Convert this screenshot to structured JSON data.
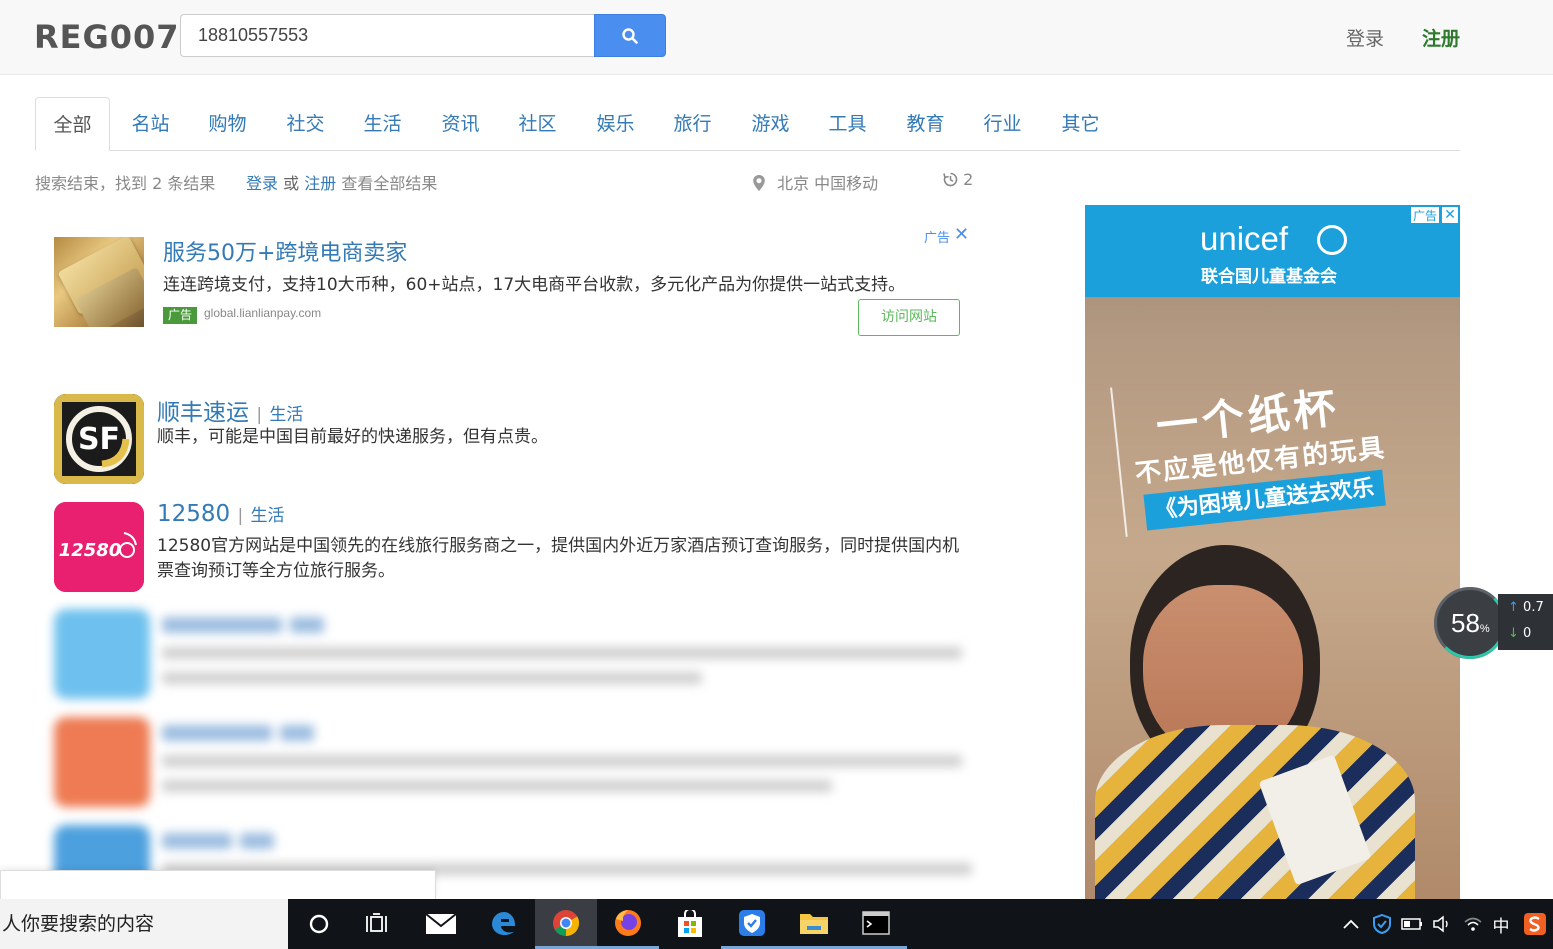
{
  "header": {
    "logo": "REG007",
    "search_value": "18810557553",
    "login": "登录",
    "register": "注册"
  },
  "tabs": [
    "全部",
    "名站",
    "购物",
    "社交",
    "生活",
    "资讯",
    "社区",
    "娱乐",
    "旅行",
    "游戏",
    "工具",
    "教育",
    "行业",
    "其它"
  ],
  "status": {
    "summary": "搜索结束，找到 2 条结果",
    "login": "登录",
    "or": "或",
    "register": "注册",
    "view_all": "查看全部结果",
    "location": "北京 中国移动",
    "history_count": "2"
  },
  "ad": {
    "title": "服务50万+跨境电商卖家",
    "description": "连连跨境支付，支持10大币种，60+站点，17大电商平台收款，多元化产品为你提供一站式支持。",
    "badge": "广告",
    "url": "global.lianlianpay.com",
    "label": "广告",
    "close": "✕",
    "visit": "访问网站"
  },
  "results": [
    {
      "name": "顺丰速运",
      "category": "生活",
      "description": "顺丰，可能是中国目前最好的快递服务，但有点贵。",
      "icon_text": "SF"
    },
    {
      "name": "12580",
      "category": "生活",
      "description": "12580官方网站是中国领先的在线旅行服务商之一，提供国内外近万家酒店预订查询服务，同时提供国内机票查询预订等全方位旅行服务。",
      "icon_text": "12580"
    }
  ],
  "banner": {
    "ad_tag": "广告",
    "close": "✕",
    "brand": "unicef",
    "subtitle": "联合国儿童基金会",
    "line1": "一个纸杯",
    "line2": "不应是他仅有的玩具",
    "line3": "《为困境儿童送去欢乐"
  },
  "speed_widget": {
    "percent": "58",
    "percent_sign": "%",
    "upload": "0.7",
    "download": "0"
  },
  "taskbar": {
    "search_text": "人你要搜索的内容",
    "ime": "中"
  },
  "colors": {
    "link": "#337ab7",
    "search_button": "#4a8ef0",
    "register": "#2d7a2d",
    "unicef": "#1ca0db"
  }
}
